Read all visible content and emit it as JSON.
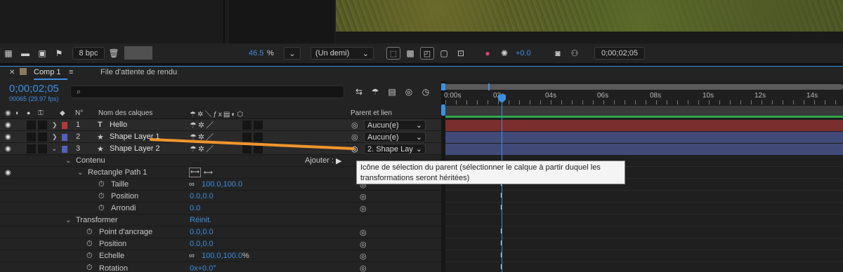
{
  "toolbar": {
    "bpc_label": "8 bpc",
    "zoom_value": "46.5",
    "zoom_unit": "%",
    "resolution": "(Un demi)",
    "exposure": "+0.0",
    "timecode": "0;00;02;05"
  },
  "tabs": {
    "comp_tab": "Comp 1",
    "render_queue_tab": "File d'attente de rendu"
  },
  "timeline": {
    "current_time": "0;00;02;05",
    "frame_info": "00065 (29.97 fps)",
    "search_placeholder": "",
    "col_number": "N°",
    "col_layer_name": "Nom des calques",
    "col_parent": "Parent et lien",
    "ruler_labels": [
      "0:00s",
      "02s",
      "04s",
      "06s",
      "08s",
      "10s",
      "12s",
      "14s"
    ]
  },
  "layers": [
    {
      "num": "1",
      "type_icon": "T",
      "name": "Hello",
      "parent": "Aucun(e)",
      "color": "#b03a3a"
    },
    {
      "num": "2",
      "type_icon": "★",
      "name": "Shape Layer 1",
      "parent": "Aucun(e)",
      "color": "#5560b8"
    },
    {
      "num": "3",
      "type_icon": "★",
      "name": "Shape Layer 2",
      "parent": "2. Shape Lay",
      "color": "#5560b8"
    }
  ],
  "properties": {
    "contents_label": "Contenu",
    "add_label": "Ajouter :",
    "rect_path_label": "Rectangle Path 1",
    "size_label": "Taille",
    "size_value": "100.0,100.0",
    "position_label": "Position",
    "position_value": "0.0,0.0",
    "roundness_label": "Arrondi",
    "roundness_value": "0.0",
    "transform_label": "Transformer",
    "reset_label": "Réinit.",
    "anchor_label": "Point d'ancrage",
    "anchor_value": "0.0,0.0",
    "t_position_label": "Position",
    "t_position_value": "0.0,0.0",
    "scale_label": "Echelle",
    "scale_value": "100.0,100.0",
    "scale_unit": "%",
    "rotation_label": "Rotation",
    "rotation_value": "0x+0.0°"
  },
  "tooltip": {
    "text": "Icône de sélection du parent (sélectionner le calque à partir duquel les transformations seront héritées)"
  },
  "colors": {
    "accent": "#3d8fe0",
    "track_hello": "#7a2e2e",
    "track_shape": "#424a78",
    "drag_line": "#f0962c"
  }
}
